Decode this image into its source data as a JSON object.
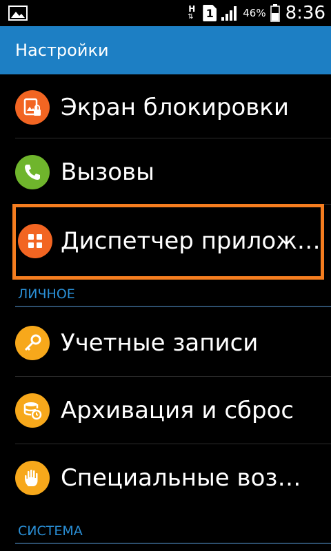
{
  "status_bar": {
    "network_type": "H",
    "sim_slot": "1",
    "battery_percent": "46%",
    "time": "8:36",
    "icons": [
      "gallery-icon",
      "data-activity-icon",
      "sim-icon",
      "signal-icon",
      "battery-icon"
    ]
  },
  "action_bar": {
    "title": "Настройки",
    "background_color": "#1d7fc4"
  },
  "items": [
    {
      "label": "Экран блокировки",
      "icon": "lock-screen-icon",
      "icon_color": "#f26522"
    },
    {
      "label": "Вызовы",
      "icon": "phone-icon",
      "icon_color": "#6fb52c"
    },
    {
      "label": "Диспетчер прилож…",
      "icon": "apps-grid-icon",
      "icon_color": "#f26522",
      "highlighted": true
    }
  ],
  "section_personal": {
    "title": "ЛИЧНОЕ",
    "items": [
      {
        "label": "Учетные записи",
        "icon": "key-icon",
        "icon_color": "#f7a81b"
      },
      {
        "label": "Архивация и сброс",
        "icon": "backup-icon",
        "icon_color": "#f7a81b"
      },
      {
        "label": "Специальные воз…",
        "icon": "hand-icon",
        "icon_color": "#f7a81b"
      }
    ]
  },
  "section_system": {
    "title": "СИСТЕМА"
  },
  "highlight_color": "#f57d1f"
}
